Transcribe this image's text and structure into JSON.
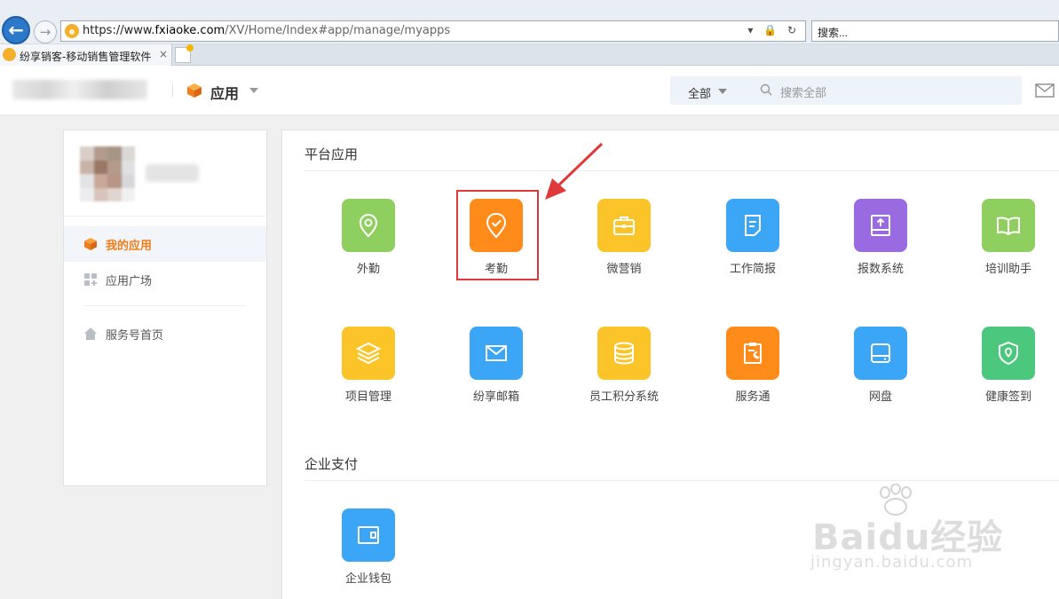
{
  "browser": {
    "url_prefix": "https://www.",
    "url_domain": "fxiaoke.com",
    "url_path": "/XV/Home/Index#app/manage/myapps",
    "search_placeholder": "搜索...",
    "tab_title": "纷享销客-移动销售管理软件",
    "tab_close": "×"
  },
  "header": {
    "app_label": "应用",
    "search_scope": "全部",
    "search_placeholder": "搜索全部"
  },
  "sidebar": {
    "items": [
      {
        "label": "我的应用",
        "icon": "cube-icon",
        "active": true
      },
      {
        "label": "应用广场",
        "icon": "grid-plus-icon",
        "active": false
      },
      {
        "label": "服务号首页",
        "icon": "home-icon",
        "active": false
      }
    ]
  },
  "main": {
    "section_platform": "平台应用",
    "section_payment": "企业支付",
    "platform_apps": [
      {
        "label": "外勤",
        "icon": "location-pin-icon",
        "color": "#8fcf5f"
      },
      {
        "label": "考勤",
        "icon": "check-pin-icon",
        "color": "#ff8c1a"
      },
      {
        "label": "微营销",
        "icon": "briefcase-icon",
        "color": "#fbc52a"
      },
      {
        "label": "工作简报",
        "icon": "document-icon",
        "color": "#3ba6f5"
      },
      {
        "label": "报数系统",
        "icon": "upload-screen-icon",
        "color": "#9a6ae0"
      },
      {
        "label": "培训助手",
        "icon": "book-icon",
        "color": "#8fcf5f"
      },
      {
        "label": "项目管理",
        "icon": "layers-icon",
        "color": "#fbc52a"
      },
      {
        "label": "纷享邮箱",
        "icon": "envelope-icon",
        "color": "#3ba6f5"
      },
      {
        "label": "员工积分系统",
        "icon": "database-icon",
        "color": "#fbc52a"
      },
      {
        "label": "服务通",
        "icon": "clipboard-tool-icon",
        "color": "#ff8c1a"
      },
      {
        "label": "网盘",
        "icon": "drive-icon",
        "color": "#3ba6f5"
      },
      {
        "label": "健康签到",
        "icon": "shield-pin-icon",
        "color": "#4cc77e"
      }
    ],
    "payment_apps": [
      {
        "label": "企业钱包",
        "icon": "wallet-icon",
        "color": "#3ba6f5"
      }
    ]
  },
  "watermark": {
    "line1": "Baidu经验",
    "line2": "jingyan.baidu.com"
  }
}
